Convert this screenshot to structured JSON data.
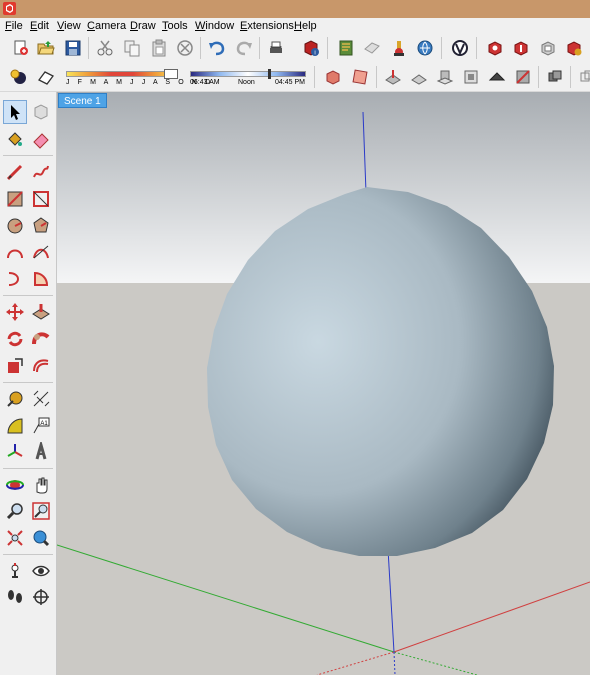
{
  "window": {
    "logo_icon": "sketchup-logo-icon"
  },
  "menu": [
    {
      "label": "File",
      "u": "F",
      "rest": "ile"
    },
    {
      "label": "Edit",
      "u": "E",
      "rest": "dit"
    },
    {
      "label": "View",
      "u": "V",
      "rest": "iew"
    },
    {
      "label": "Camera",
      "u": "C",
      "rest": "amera"
    },
    {
      "label": "Draw",
      "u": "D",
      "rest": "raw"
    },
    {
      "label": "Tools",
      "u": "T",
      "rest": "ools"
    },
    {
      "label": "Window",
      "u": "W",
      "rest": "indow"
    },
    {
      "label": "Extensions",
      "u": "E",
      "rest": "xtensions"
    },
    {
      "label": "Help",
      "u": "H",
      "rest": "elp"
    }
  ],
  "shadows": {
    "months": "J F M A M J J A S O N D",
    "time_start": "06:43 AM",
    "time_mid": "Noon",
    "time_end": "04:45 PM"
  },
  "scene": {
    "tab_label": "Scene 1"
  },
  "colors": {
    "sky_top": "#a8adb2",
    "sky_bottom": "#f4f5f6",
    "ground": "#cbc9c5",
    "sphere_light": "#c9d8e1",
    "sphere_dark": "#3b4a55",
    "axis_red": "#d04040",
    "axis_green": "#33aa33",
    "axis_blue": "#2a3ac8",
    "scene_tab": "#4ea3e6"
  },
  "toolbar_icons_row1": [
    "new-icon",
    "open-icon",
    "save-icon",
    "cut-icon",
    "copy-icon",
    "paste-icon",
    "erase-icon",
    "undo-icon",
    "redo-icon",
    "print-icon",
    "model-info-icon",
    "3d-warehouse-icon",
    "share-model-icon",
    "extension-warehouse-icon",
    "geolocation-icon",
    "vray-icon",
    "dynamic-component-icon",
    "interact-icon",
    "options-icon",
    "attributes-icon"
  ],
  "toolbar_icons_row2": [
    "shadows-toggle-icon",
    "fog-icon",
    "section-plane-icon",
    "section-display-icon",
    "sandbox-icon",
    "smoove-icon",
    "stamp-icon",
    "drape-icon",
    "add-detail-icon",
    "flip-edge-icon",
    "xray-icon",
    "back-edges-icon",
    "wireframe-icon"
  ],
  "left_tools": [
    "select-icon",
    "make-component-icon",
    "paint-bucket-icon",
    "eraser-icon",
    "line-icon",
    "freehand-icon",
    "rectangle-icon",
    "rotated-rectangle-icon",
    "circle-icon",
    "polygon-icon",
    "arc-icon",
    "2-point-arc-icon",
    "3-point-arc-icon",
    "pie-icon",
    "move-icon",
    "push-pull-icon",
    "rotate-icon",
    "follow-me-icon",
    "scale-icon",
    "offset-icon",
    "tape-measure-icon",
    "dimension-icon",
    "protractor-icon",
    "text-icon",
    "axes-icon",
    "3d-text-icon",
    "orbit-icon",
    "pan-icon",
    "zoom-icon",
    "zoom-window-icon",
    "zoom-extents-icon",
    "previous-view-icon",
    "position-camera-icon",
    "look-around-icon",
    "walk-icon",
    "section-plane-icon"
  ]
}
